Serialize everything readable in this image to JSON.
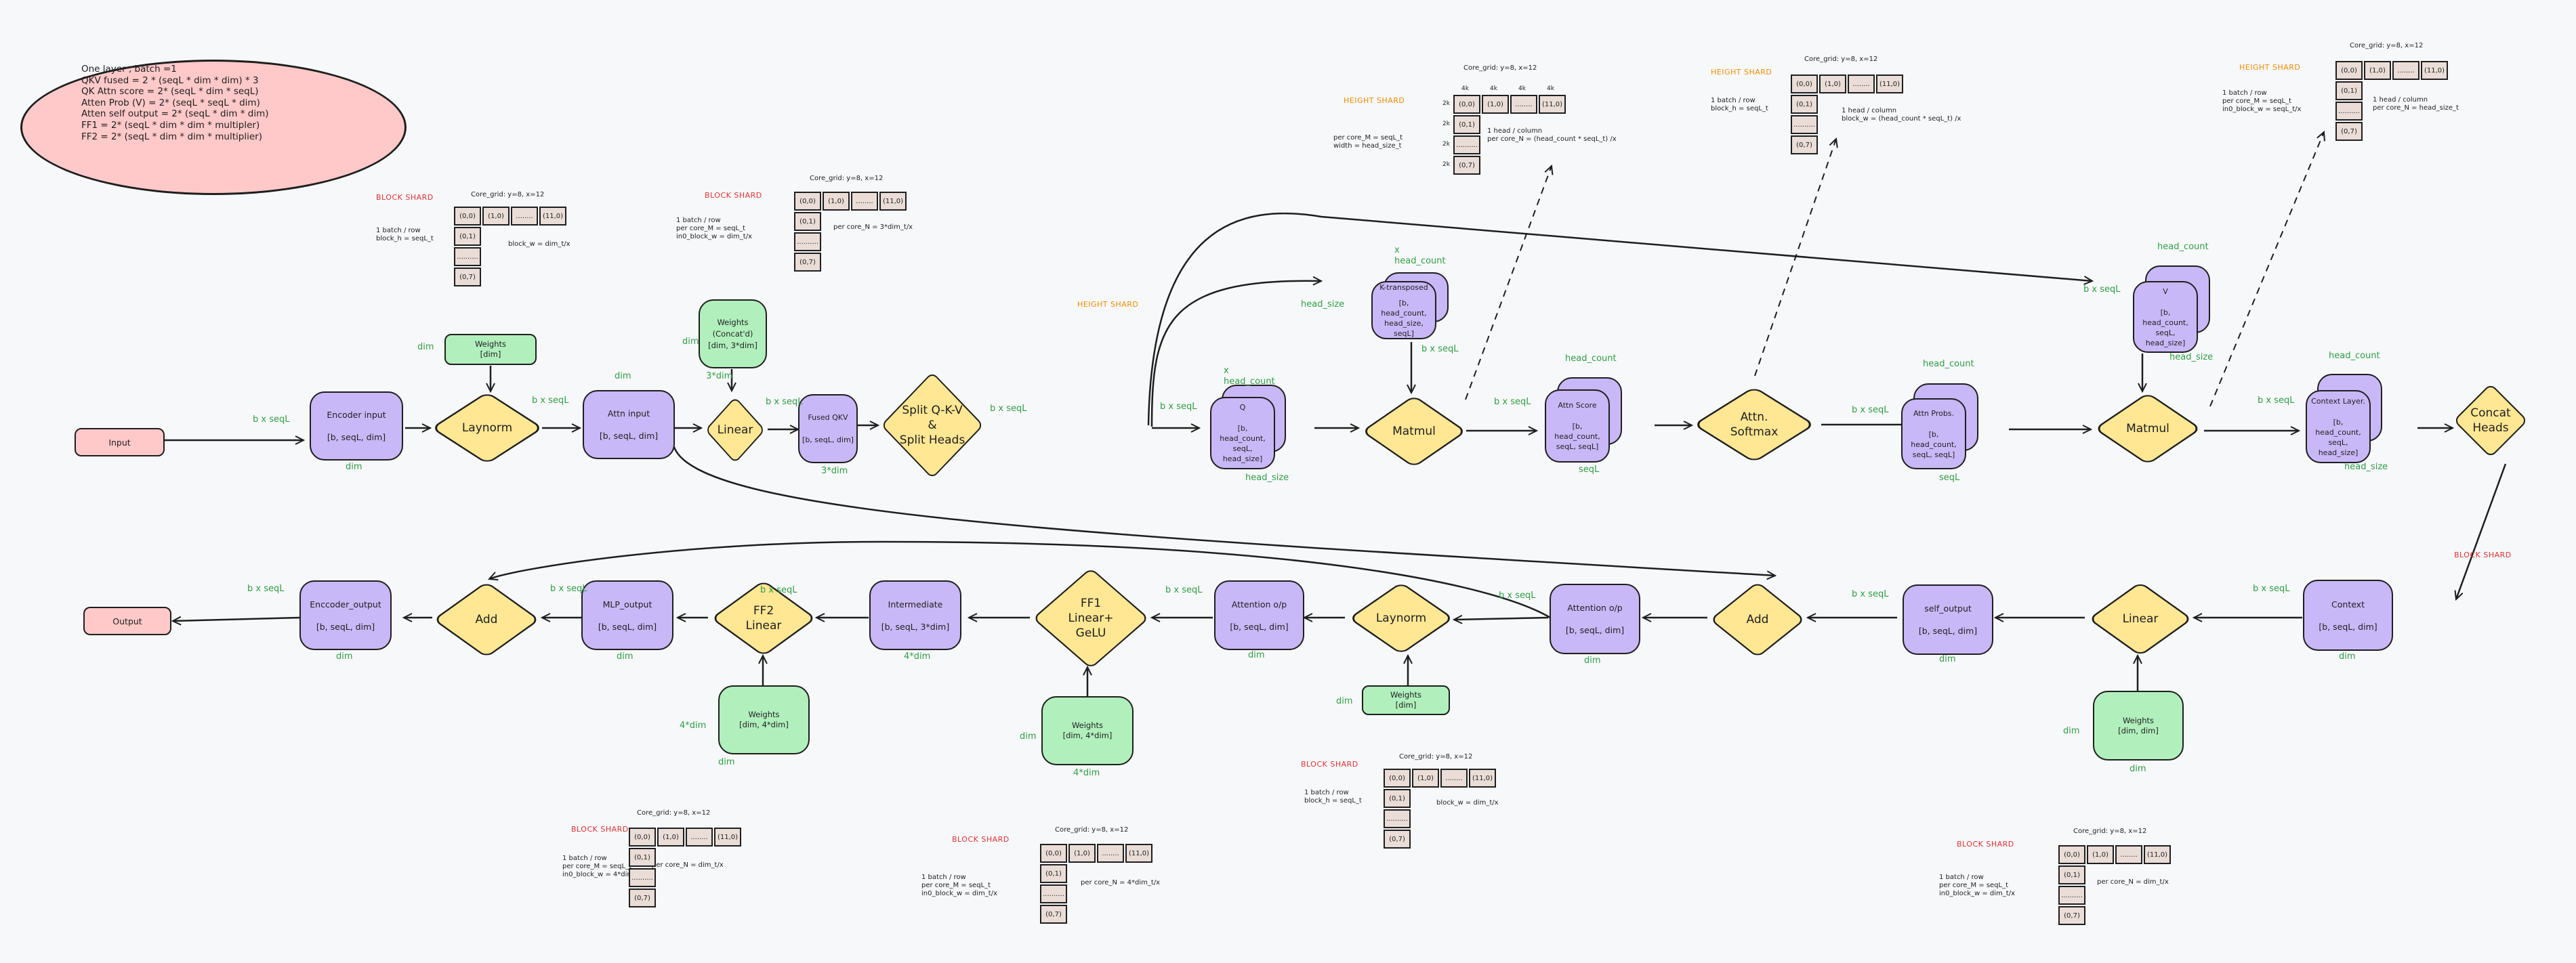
{
  "note": {
    "lines": [
      "One layer , batch =1",
      "QKV fused = 2 * (seqL * dim * dim) * 3",
      "QK Attn score = 2* (seqL * dim * seqL)",
      "Atten Prob (V) = 2* (seqL * seqL * dim)",
      "Atten self output = 2* (seqL * dim * dim)",
      "FF1 = 2* (seqL * dim * dim * multipler)",
      "FF2 = 2* (seqL * dim * dim * multiplier)"
    ]
  },
  "colors": {
    "tensor": "#c9b8f7",
    "weights": "#b1f0bd",
    "op": "#ffe794",
    "io": "#ffc9c9",
    "dim_label": "#2f9e44",
    "block_shard": "#e03131",
    "height_shard": "#f08c00",
    "core_cell": "#eaddd7"
  },
  "nodes": {
    "input": {
      "label": "Input"
    },
    "output": {
      "label": "Output"
    },
    "encoder_input": {
      "title": "Encoder input",
      "shape": "[b, seqL, dim]"
    },
    "attn_input": {
      "title": "Attn input",
      "shape": "[b, seqL, dim]"
    },
    "fused_qkv": {
      "title": "Fused QKV",
      "shape": "[b, seqL, dim]"
    },
    "q": {
      "title": "Q",
      "shape": "[b, head_count, seqL, head_size]"
    },
    "k_transposed": {
      "title": "K-transposed",
      "shape": "[b, head_count, head_size, seqL]"
    },
    "attn_score": {
      "title": "Attn Score",
      "shape": "[b, head_count, seqL, seqL]"
    },
    "attn_probs": {
      "title": "Attn Probs.",
      "shape": "[b, head_count, seqL, seqL]"
    },
    "v": {
      "title": "V",
      "shape": "[b, head_count, seqL, head_size]"
    },
    "context_layer": {
      "title": "Context Layer.",
      "shape": "[b, head_count, seqL, head_size]"
    },
    "context": {
      "title": "Context",
      "shape": "[b, seqL, dim]"
    },
    "self_output": {
      "title": "self_output",
      "shape": "[b, seqL, dim]"
    },
    "attention_op_1": {
      "title": "Attention o/p",
      "shape": "[b, seqL, dim]"
    },
    "attention_op_2": {
      "title": "Attention o/p",
      "shape": "[b, seqL, dim]"
    },
    "intermediate": {
      "title": "Intermediate",
      "shape": "[b, seqL, 3*dim]"
    },
    "mlp_output": {
      "title": "MLP_output",
      "shape": "[b, seqL, dim]"
    },
    "encoder_output": {
      "title": "Enccoder_output",
      "shape": "[b, seqL, dim]"
    },
    "w_layernorm1": {
      "title": "Weights",
      "shape": "[dim]"
    },
    "w_qkv": {
      "title": "Weights\n(Concat'd)",
      "shape": "[dim, 3*dim]"
    },
    "w_linear_out": {
      "title": "Weights",
      "shape": "[dim, dim]"
    },
    "w_layernorm2": {
      "title": "Weights",
      "shape": "[dim]"
    },
    "w_ff1": {
      "title": "Weights",
      "shape": "[dim, 4*dim]"
    },
    "w_ff2": {
      "title": "Weights",
      "shape": "[dim, 4*dim]"
    }
  },
  "ops": {
    "layernorm1": "Laynorm",
    "linear_qkv": "Linear",
    "split": "Split Q-K-V\n&\nSplit Heads",
    "matmul1": "Matmul",
    "softmax": "Attn.\nSoftmax",
    "matmul2": "Matmul",
    "concat_heads": "Concat\nHeads",
    "linear_out": "Linear",
    "add1": "Add",
    "layernorm2": "Laynorm",
    "ff1": "FF1\nLinear+\nGeLU",
    "ff2": "FF2\nLinear",
    "add2": "Add"
  },
  "dim_labels": {
    "b_x_seql": "b x seqL",
    "dim": "dim",
    "three_dim": "3*dim",
    "four_dim": "4*dim",
    "head_count": "head_count",
    "x_head_count": "x\nhead_count",
    "head_size": "head_size",
    "seql": "seqL"
  },
  "shard_labels": {
    "block": "BLOCK SHARD",
    "height": "HEIGHT SHARD"
  },
  "core_grid": {
    "title": "Core_grid: y=8, x=12",
    "cells_row": [
      "(0,0)",
      "(1,0)",
      "........",
      "(11,0)"
    ],
    "cells_col": [
      "(0,1)",
      "..........",
      "(0,7)"
    ],
    "size_tags_top": [
      "4k",
      "4k",
      "4k",
      "4k"
    ],
    "size_tags_left": [
      "2k",
      "2k",
      "2k",
      "2k"
    ]
  },
  "shard_specs": [
    {
      "id": "layernorm1",
      "type": "block",
      "left": "1 batch / row\nblock_h = seqL_t",
      "right": "block_w = dim_t/x"
    },
    {
      "id": "qkv_linear",
      "type": "block",
      "left": "1 batch / row\nper core_M = seqL_t\nin0_block_w = dim_t/x",
      "right": "per core_N = 3*dim_t/x"
    },
    {
      "id": "qk_matmul",
      "type": "height",
      "left": "per core_M = seqL_t\nwidth = head_size_t",
      "right": "1 head / column\nper core_N = (head_count * seqL_t) /x"
    },
    {
      "id": "softmax",
      "type": "height",
      "left": "1 batch / row\nblock_h = seqL_t",
      "right": "1 head / column\nblock_w = (head_count * seqL_t) /x"
    },
    {
      "id": "attn_v_matmul",
      "type": "height",
      "left": "1 batch / row\nper core_M = seqL_t\nin0_block_w = seqL_t/x",
      "right": "1 head / column\nper core_N = head_size_t"
    },
    {
      "id": "ff2",
      "type": "block",
      "left": "1 batch / row\nper core_M = seqL_t\nin0_block_w = 4*dim_t/x",
      "right": "per core_N = dim_t/x"
    },
    {
      "id": "ff1",
      "type": "block",
      "left": "1 batch / row\nper core_M = seqL_t\nin0_block_w = dim_t/x",
      "right": "per core_N = 4*dim_t/x"
    },
    {
      "id": "layernorm2",
      "type": "block",
      "left": "1 batch / row\nblock_h = seqL_t",
      "right": "block_w = dim_t/x"
    },
    {
      "id": "self_out_linear",
      "type": "block",
      "left": "1 batch / row\nper core_M = seqL_t\nin0_block_w = dim_t/x",
      "right": "per core_N = dim_t/x"
    }
  ]
}
